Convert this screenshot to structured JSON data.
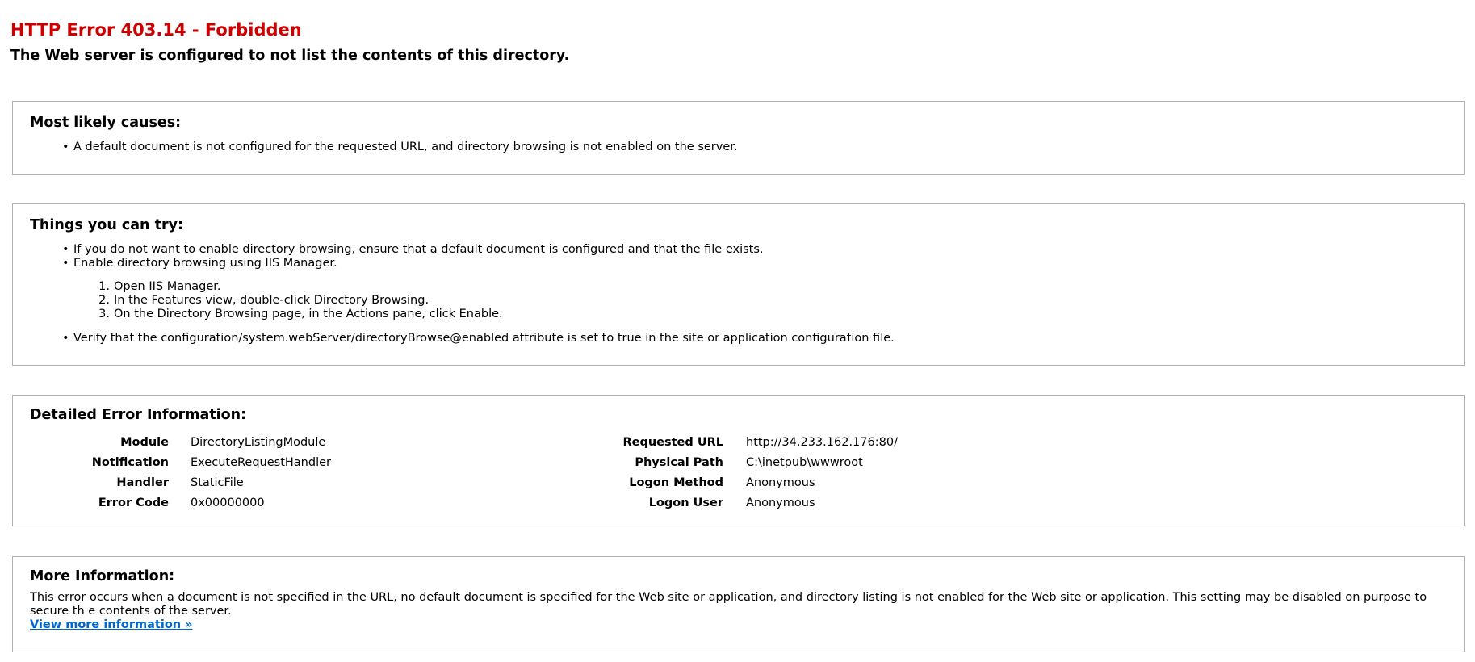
{
  "page": {
    "title": "HTTP Error 403.14 - Forbidden",
    "subtitle": "The Web server is configured to not list the contents of this directory."
  },
  "causes": {
    "heading": "Most likely causes:",
    "items": [
      "A default document is not configured for the requested URL, and directory browsing is not enabled on the server."
    ]
  },
  "try": {
    "heading": "Things you can try:",
    "items": [
      "If you do not want to enable directory browsing, ensure that a default document is configured and that the file exists.",
      "Enable directory browsing using IIS Manager."
    ],
    "steps": [
      "Open IIS Manager.",
      "In the Features view, double-click Directory Browsing.",
      "On the Directory Browsing page, in the Actions pane, click Enable."
    ],
    "last_item": "Verify that the configuration/system.webServer/directoryBrowse@enabled attribute is set to true in the site or application configuration file."
  },
  "details": {
    "heading": "Detailed Error Information:",
    "left": [
      {
        "label": "Module",
        "value": "DirectoryListingModule"
      },
      {
        "label": "Notification",
        "value": "ExecuteRequestHandler"
      },
      {
        "label": "Handler",
        "value": "StaticFile"
      },
      {
        "label": "Error Code",
        "value": "0x00000000"
      }
    ],
    "right": [
      {
        "label": "Requested URL",
        "value": "http://34.233.162.176:80/"
      },
      {
        "label": "Physical Path",
        "value": "C:\\inetpub\\wwwroot"
      },
      {
        "label": "Logon Method",
        "value": "Anonymous"
      },
      {
        "label": "Logon User",
        "value": "Anonymous"
      }
    ]
  },
  "more": {
    "heading": "More Information:",
    "text": "This error occurs when a document is not specified in the URL, no default document is specified for the Web site or application, and directory listing is not enabled for the Web site or application. This setting may be disabled on purpose to secure th e contents of the server.",
    "link_label": "View more information »"
  },
  "colors": {
    "title": "#cc0000",
    "link": "#0066cc",
    "border": "#b0b0b0"
  }
}
